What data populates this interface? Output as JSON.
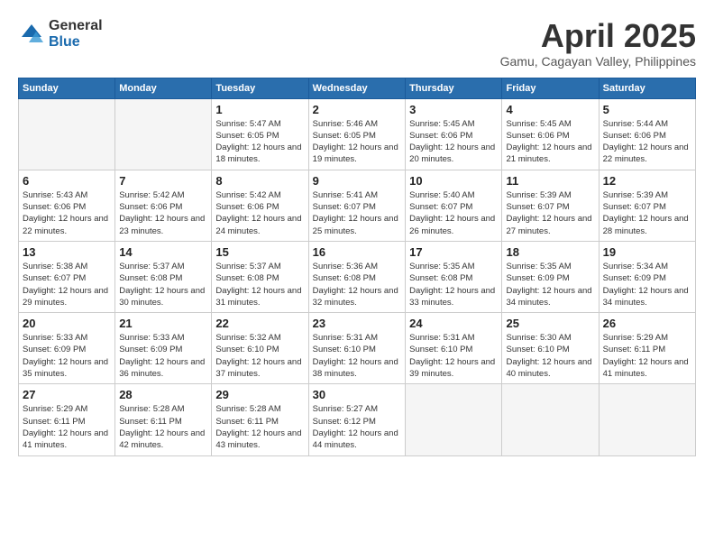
{
  "logo": {
    "general": "General",
    "blue": "Blue"
  },
  "title": {
    "month": "April 2025",
    "location": "Gamu, Cagayan Valley, Philippines"
  },
  "weekdays": [
    "Sunday",
    "Monday",
    "Tuesday",
    "Wednesday",
    "Thursday",
    "Friday",
    "Saturday"
  ],
  "weeks": [
    [
      {
        "day": "",
        "empty": true
      },
      {
        "day": "",
        "empty": true
      },
      {
        "day": "1",
        "sunrise": "5:47 AM",
        "sunset": "6:05 PM",
        "daylight": "12 hours and 18 minutes."
      },
      {
        "day": "2",
        "sunrise": "5:46 AM",
        "sunset": "6:05 PM",
        "daylight": "12 hours and 19 minutes."
      },
      {
        "day": "3",
        "sunrise": "5:45 AM",
        "sunset": "6:06 PM",
        "daylight": "12 hours and 20 minutes."
      },
      {
        "day": "4",
        "sunrise": "5:45 AM",
        "sunset": "6:06 PM",
        "daylight": "12 hours and 21 minutes."
      },
      {
        "day": "5",
        "sunrise": "5:44 AM",
        "sunset": "6:06 PM",
        "daylight": "12 hours and 22 minutes."
      }
    ],
    [
      {
        "day": "6",
        "sunrise": "5:43 AM",
        "sunset": "6:06 PM",
        "daylight": "12 hours and 22 minutes."
      },
      {
        "day": "7",
        "sunrise": "5:42 AM",
        "sunset": "6:06 PM",
        "daylight": "12 hours and 23 minutes."
      },
      {
        "day": "8",
        "sunrise": "5:42 AM",
        "sunset": "6:06 PM",
        "daylight": "12 hours and 24 minutes."
      },
      {
        "day": "9",
        "sunrise": "5:41 AM",
        "sunset": "6:07 PM",
        "daylight": "12 hours and 25 minutes."
      },
      {
        "day": "10",
        "sunrise": "5:40 AM",
        "sunset": "6:07 PM",
        "daylight": "12 hours and 26 minutes."
      },
      {
        "day": "11",
        "sunrise": "5:39 AM",
        "sunset": "6:07 PM",
        "daylight": "12 hours and 27 minutes."
      },
      {
        "day": "12",
        "sunrise": "5:39 AM",
        "sunset": "6:07 PM",
        "daylight": "12 hours and 28 minutes."
      }
    ],
    [
      {
        "day": "13",
        "sunrise": "5:38 AM",
        "sunset": "6:07 PM",
        "daylight": "12 hours and 29 minutes."
      },
      {
        "day": "14",
        "sunrise": "5:37 AM",
        "sunset": "6:08 PM",
        "daylight": "12 hours and 30 minutes."
      },
      {
        "day": "15",
        "sunrise": "5:37 AM",
        "sunset": "6:08 PM",
        "daylight": "12 hours and 31 minutes."
      },
      {
        "day": "16",
        "sunrise": "5:36 AM",
        "sunset": "6:08 PM",
        "daylight": "12 hours and 32 minutes."
      },
      {
        "day": "17",
        "sunrise": "5:35 AM",
        "sunset": "6:08 PM",
        "daylight": "12 hours and 33 minutes."
      },
      {
        "day": "18",
        "sunrise": "5:35 AM",
        "sunset": "6:09 PM",
        "daylight": "12 hours and 34 minutes."
      },
      {
        "day": "19",
        "sunrise": "5:34 AM",
        "sunset": "6:09 PM",
        "daylight": "12 hours and 34 minutes."
      }
    ],
    [
      {
        "day": "20",
        "sunrise": "5:33 AM",
        "sunset": "6:09 PM",
        "daylight": "12 hours and 35 minutes."
      },
      {
        "day": "21",
        "sunrise": "5:33 AM",
        "sunset": "6:09 PM",
        "daylight": "12 hours and 36 minutes."
      },
      {
        "day": "22",
        "sunrise": "5:32 AM",
        "sunset": "6:10 PM",
        "daylight": "12 hours and 37 minutes."
      },
      {
        "day": "23",
        "sunrise": "5:31 AM",
        "sunset": "6:10 PM",
        "daylight": "12 hours and 38 minutes."
      },
      {
        "day": "24",
        "sunrise": "5:31 AM",
        "sunset": "6:10 PM",
        "daylight": "12 hours and 39 minutes."
      },
      {
        "day": "25",
        "sunrise": "5:30 AM",
        "sunset": "6:10 PM",
        "daylight": "12 hours and 40 minutes."
      },
      {
        "day": "26",
        "sunrise": "5:29 AM",
        "sunset": "6:11 PM",
        "daylight": "12 hours and 41 minutes."
      }
    ],
    [
      {
        "day": "27",
        "sunrise": "5:29 AM",
        "sunset": "6:11 PM",
        "daylight": "12 hours and 41 minutes."
      },
      {
        "day": "28",
        "sunrise": "5:28 AM",
        "sunset": "6:11 PM",
        "daylight": "12 hours and 42 minutes."
      },
      {
        "day": "29",
        "sunrise": "5:28 AM",
        "sunset": "6:11 PM",
        "daylight": "12 hours and 43 minutes."
      },
      {
        "day": "30",
        "sunrise": "5:27 AM",
        "sunset": "6:12 PM",
        "daylight": "12 hours and 44 minutes."
      },
      {
        "day": "",
        "empty": true
      },
      {
        "day": "",
        "empty": true
      },
      {
        "day": "",
        "empty": true
      }
    ]
  ]
}
